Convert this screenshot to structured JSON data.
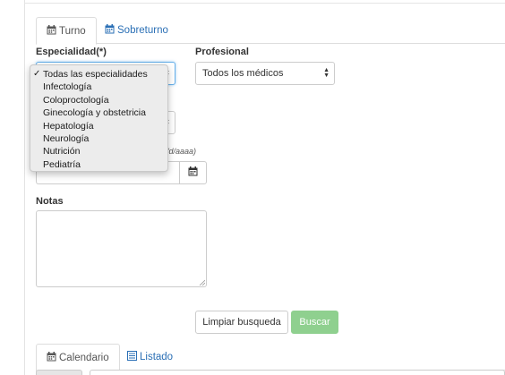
{
  "tabs_top": [
    {
      "label": "Turno",
      "icon": "calendar-icon",
      "active": true
    },
    {
      "label": "Sobreturno",
      "icon": "calendar-icon",
      "active": false
    }
  ],
  "form": {
    "especialidad_label": "Especialidad(*)",
    "profesional_label": "Profesional",
    "profesional_value": "Todos los médicos",
    "date_hint": "/d/aaaa)",
    "notas_label": "Notas"
  },
  "especialidad_dropdown": {
    "selected": "Todas las especialidades",
    "options": [
      "Todas las especialidades",
      "Infectología",
      "Coloproctología",
      "Ginecología y obstetricia",
      "Hepatología",
      "Neurología",
      "Nutrición",
      "Pediatría"
    ]
  },
  "buttons": {
    "clear": "Limpiar busqueda",
    "search": "Buscar"
  },
  "tabs_bottom": [
    {
      "label": "Calendario",
      "icon": "calendar-icon",
      "active": true
    },
    {
      "label": "Listado",
      "icon": "list-icon",
      "active": false
    }
  ],
  "colors": {
    "link": "#2a6fb5",
    "success": "#8fd08f",
    "focus": "#66afe9"
  }
}
